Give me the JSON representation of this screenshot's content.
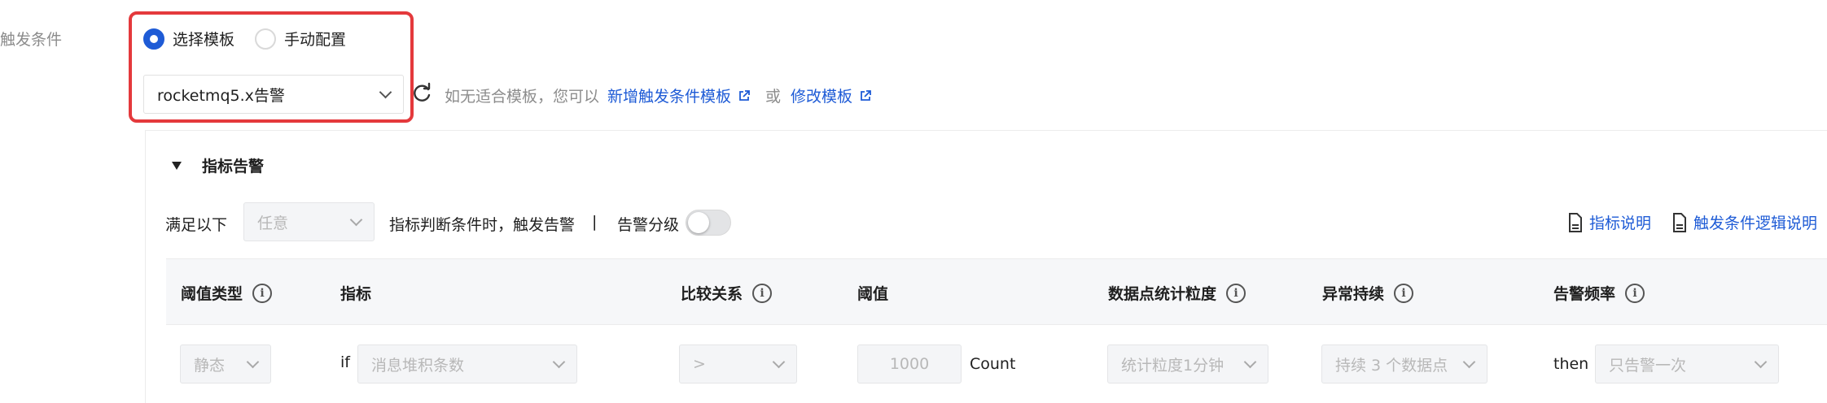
{
  "field_label": "触发条件",
  "mode": {
    "template_label": "选择模板",
    "manual_label": "手动配置",
    "selected": "template"
  },
  "template_select": {
    "value": "rocketmq5.x告警"
  },
  "hint": {
    "prefix": "如无适合模板，您可以",
    "add_link": "新增触发条件模板",
    "or": "或",
    "modify_link": "修改模板"
  },
  "section": {
    "title": "指标告警"
  },
  "condition": {
    "prefix": "满足以下",
    "match_value": "任意",
    "suffix": "指标判断条件时，触发告警",
    "separator": "|",
    "level_label": "告警分级",
    "level_enabled": false
  },
  "links": {
    "metric_doc": "指标说明",
    "logic_doc": "触发条件逻辑说明"
  },
  "table": {
    "headers": {
      "threshold_type": "阈值类型",
      "metric": "指标",
      "compare": "比较关系",
      "threshold": "阈值",
      "granularity": "数据点统计粒度",
      "duration": "异常持续",
      "frequency": "告警频率"
    },
    "row": {
      "threshold_type": "静态",
      "if_label": "if",
      "metric": "消息堆积条数",
      "compare": ">",
      "threshold_value": "1000",
      "unit": "Count",
      "granularity": "统计粒度1分钟",
      "duration": "持续 3 个数据点",
      "then_label": "then",
      "frequency": "只告警一次"
    }
  },
  "colors": {
    "accent": "#1e5bd6",
    "highlight_frame": "#e4393c"
  }
}
